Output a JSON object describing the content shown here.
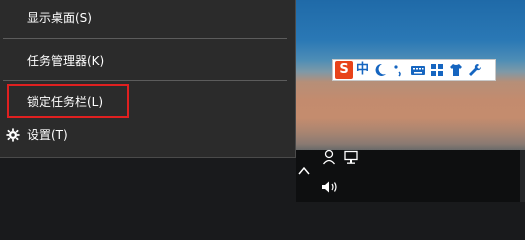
{
  "context_menu": {
    "items": [
      {
        "label": "显示桌面(S)"
      },
      {
        "label": "任务管理器(K)"
      },
      {
        "label": "锁定任务栏(L)"
      },
      {
        "label": "设置(T)"
      }
    ]
  },
  "ime_toolbar": {
    "logo": "S",
    "mode": "中",
    "icons": [
      "moon-icon",
      "punctuation-icon",
      "keyboard-icon",
      "grid-icon",
      "shirt-icon",
      "wrench-icon"
    ]
  },
  "tray_icons": [
    "chevron-up-icon",
    "user-notification-icon",
    "network-icon",
    "volume-icon"
  ],
  "colors": {
    "menu_bg": "#2b2b2b",
    "highlight": "#e02020",
    "ime_logo": "#e8431a",
    "ime_icon_blue": "#1565c0"
  }
}
